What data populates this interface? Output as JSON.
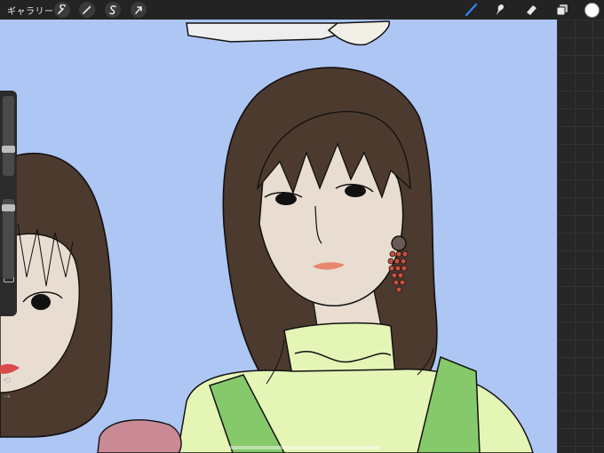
{
  "app": {
    "gallery_label": "ギャラリー"
  },
  "toolbar": {
    "left_tools": [
      "actions-wrench",
      "adjustments-wand",
      "selection-s",
      "transform-arrow"
    ],
    "right_tools": [
      "brush",
      "smudge",
      "eraser",
      "layers"
    ],
    "active_tool": "brush",
    "active_tool_color": "#2e8bff",
    "current_color": "#ffffff"
  },
  "canvas": {
    "background_color": "#aec6f4"
  }
}
